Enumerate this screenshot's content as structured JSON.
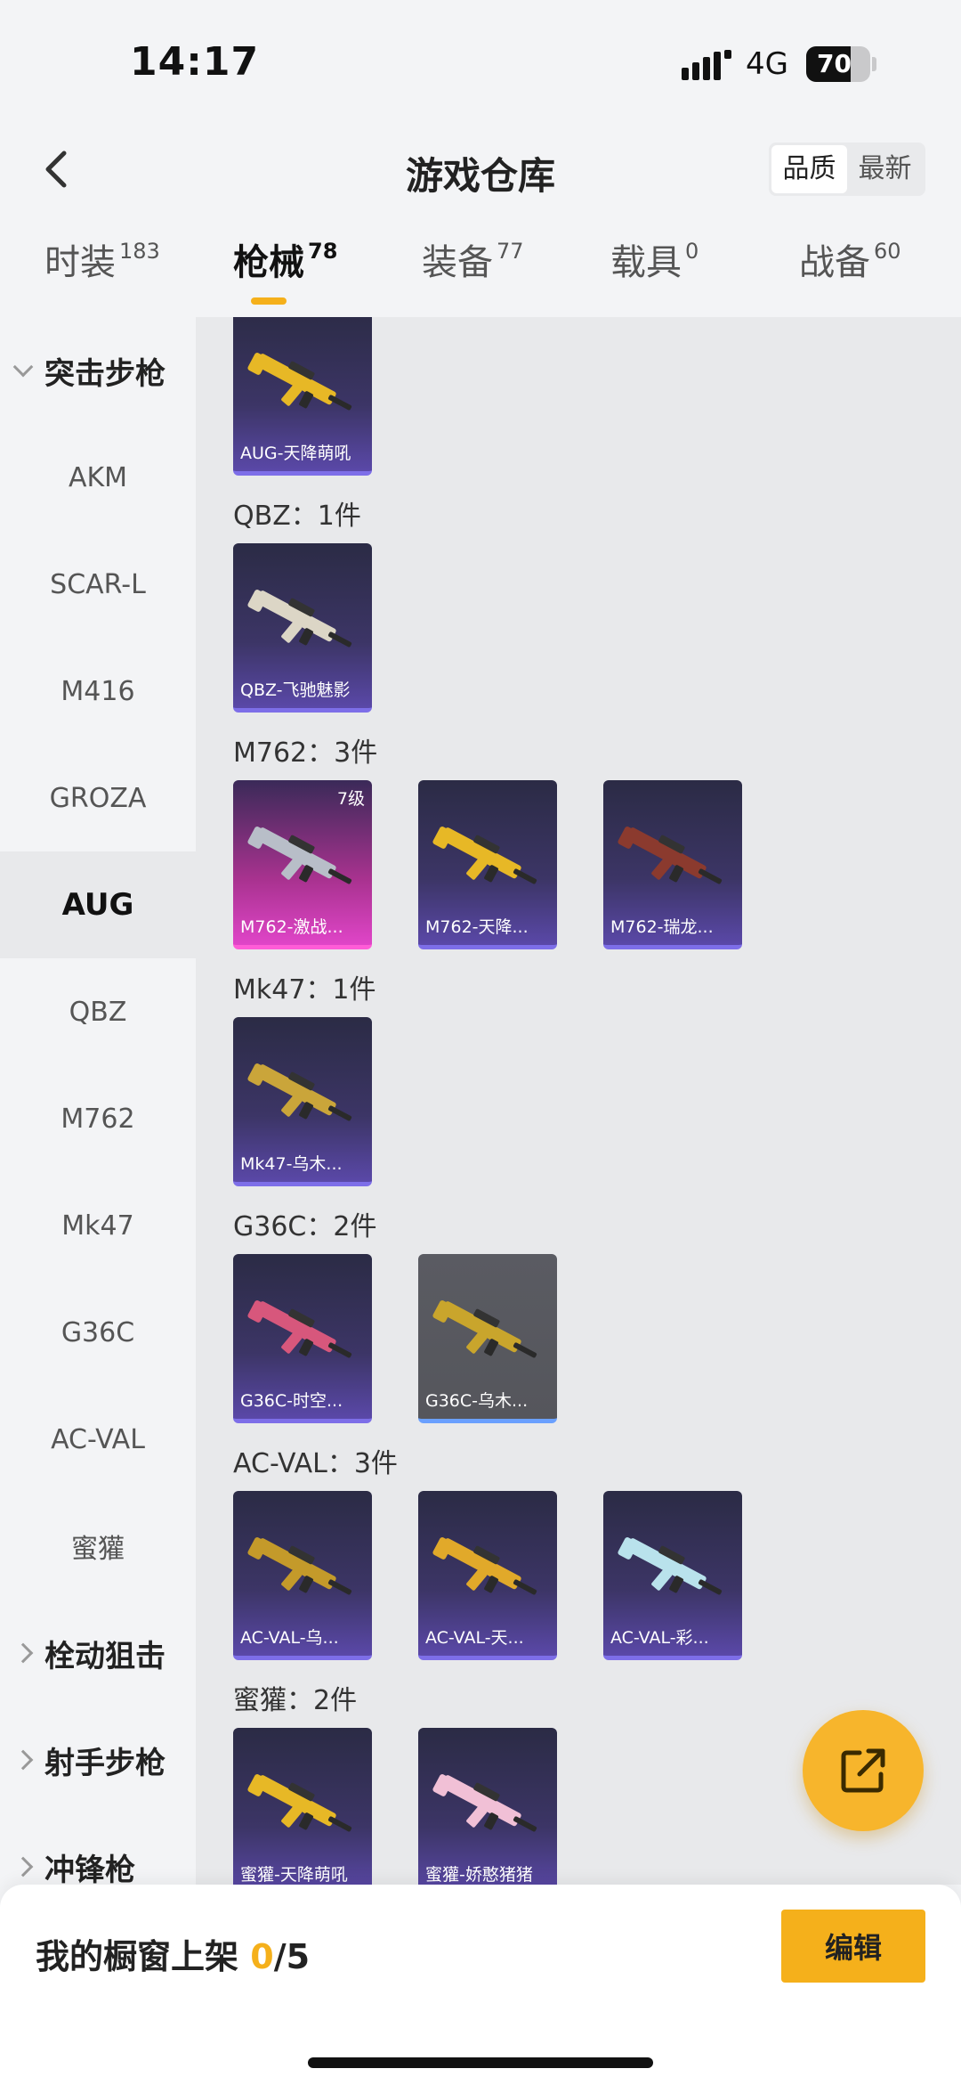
{
  "status": {
    "time": "14:17",
    "network": "4G",
    "battery": "70",
    "battery_level": 0.7
  },
  "header": {
    "title": "游戏仓库",
    "sort_options": [
      "品质",
      "最新"
    ],
    "sort_active": "品质"
  },
  "tabs": [
    {
      "label": "时装",
      "count": "183"
    },
    {
      "label": "枪械",
      "count": "78",
      "active": true
    },
    {
      "label": "装备",
      "count": "77"
    },
    {
      "label": "载具",
      "count": "0"
    },
    {
      "label": "战备",
      "count": "60"
    }
  ],
  "sidebar": {
    "groups": [
      {
        "label": "突击步枪",
        "expanded": true
      },
      {
        "label": "栓动狙击",
        "expanded": false
      },
      {
        "label": "射手步枪",
        "expanded": false
      },
      {
        "label": "冲锋枪",
        "expanded": false
      }
    ],
    "items": [
      "AKM",
      "SCAR-L",
      "M416",
      "GROZA",
      "AUG",
      "QBZ",
      "M762",
      "Mk47",
      "G36C",
      "AC-VAL",
      "蜜獾"
    ],
    "active_item": "AUG"
  },
  "content": {
    "sections": [
      {
        "title": "",
        "items": [
          {
            "name": "AUG-天降萌吼",
            "rarity": "purple",
            "weapon_color": "#e7b826"
          }
        ]
      },
      {
        "title": "QBZ：1件",
        "items": [
          {
            "name": "QBZ-飞驰魅影",
            "rarity": "purple",
            "weapon_color": "#dcd6c6"
          }
        ]
      },
      {
        "title": "M762：3件",
        "items": [
          {
            "name": "M762-激战...",
            "rarity": "pink",
            "level": "7级",
            "weapon_color": "#b8bec8"
          },
          {
            "name": "M762-天降...",
            "rarity": "purple",
            "weapon_color": "#e7b826"
          },
          {
            "name": "M762-瑞龙...",
            "rarity": "purple",
            "weapon_color": "#8b3a2e"
          }
        ]
      },
      {
        "title": "Mk47：1件",
        "items": [
          {
            "name": "Mk47-乌木...",
            "rarity": "purple",
            "weapon_color": "#caa53a"
          }
        ]
      },
      {
        "title": "G36C：2件",
        "items": [
          {
            "name": "G36C-时空...",
            "rarity": "purple",
            "weapon_color": "#d7577c"
          },
          {
            "name": "G36C-乌木...",
            "rarity": "grey",
            "weapon_color": "#c9a52c"
          }
        ]
      },
      {
        "title": "AC-VAL：3件",
        "items": [
          {
            "name": "AC-VAL-乌...",
            "rarity": "purple",
            "weapon_color": "#c49a2a"
          },
          {
            "name": "AC-VAL-天...",
            "rarity": "purple",
            "weapon_color": "#e1a92a"
          },
          {
            "name": "AC-VAL-彩...",
            "rarity": "purple",
            "weapon_color": "#b9e2ec"
          }
        ]
      },
      {
        "title": "蜜獾：2件",
        "items": [
          {
            "name": "蜜獾-天降萌吼",
            "rarity": "purple",
            "weapon_color": "#e7b826"
          },
          {
            "name": "蜜獾-娇憨猪猪",
            "rarity": "purple",
            "weapon_color": "#f1c0d6"
          }
        ]
      }
    ]
  },
  "footer": {
    "showcase_label": "我的橱窗上架",
    "showcase_used": "0",
    "showcase_total": "/5",
    "edit_label": "编辑"
  },
  "icons": {
    "back": "back-icon",
    "share": "share-icon",
    "signal": "signal-icon"
  },
  "colors": {
    "accent": "#f5b01b",
    "purple_card": "#3c3566",
    "pink_card": "#e045c8"
  }
}
